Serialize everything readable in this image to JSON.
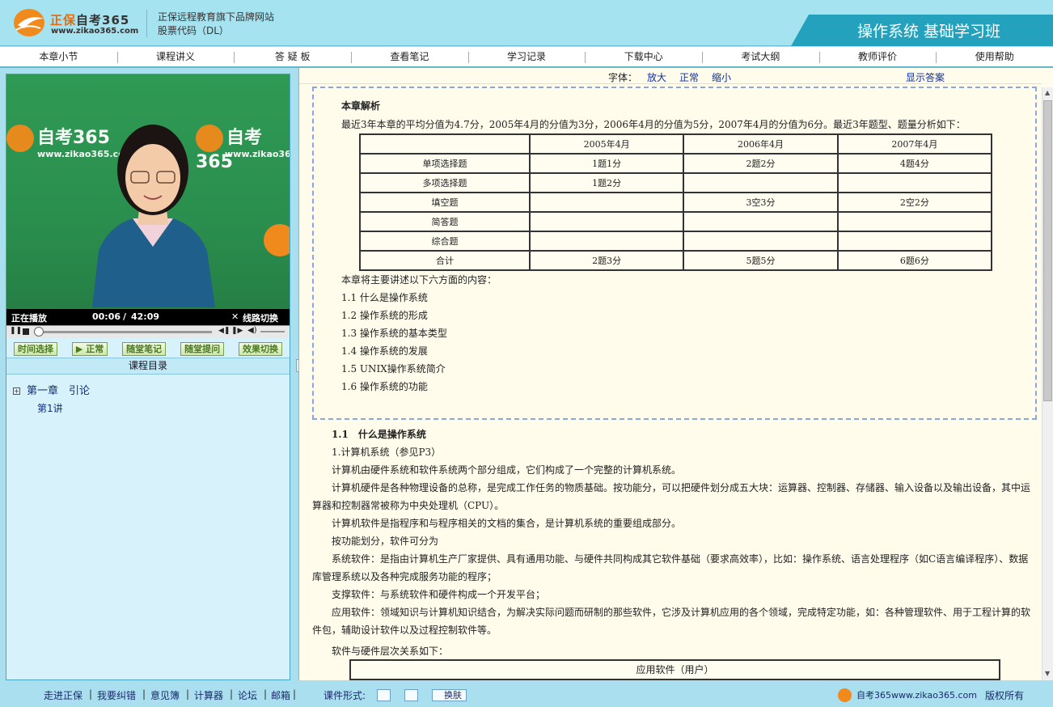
{
  "header": {
    "logo_brand": "正保",
    "logo_name": "自考365",
    "logo_url": "www.zikao365.com",
    "tagline_1": "正保远程教育旗下品牌网站",
    "tagline_2": "股票代码（DL）",
    "course_title": "操作系统 基础学习班"
  },
  "nav": [
    "本章小节",
    "课程讲义",
    "答 疑 板",
    "查看笔记",
    "学习记录",
    "下载中心",
    "考试大纲",
    "教师评价",
    "使用帮助"
  ],
  "video": {
    "watermark_text": "自考365",
    "watermark_url": "www.zikao365.com",
    "status": "正在播放",
    "time_current": "00:06",
    "time_separator": "/",
    "time_total": "42:09",
    "switch_label": "线路切换",
    "buttons": [
      "时间选择",
      "正常",
      "随堂笔记",
      "随堂提问",
      "效果切换"
    ]
  },
  "directory": {
    "title": "课程目录",
    "chapter": "第一章　引论",
    "lesson": "第1讲"
  },
  "fontbar": {
    "label": "字体：",
    "enlarge": "放大",
    "normal": "正常",
    "shrink": "缩小",
    "show_answer": "显示答案"
  },
  "analysis": {
    "heading": "本章解析",
    "intro": "最近3年本章的平均分值为4.7分，2005年4月的分值为3分，2006年4月的分值为5分，2007年4月的分值为6分。最近3年题型、题量分析如下：",
    "table": {
      "headers": [
        "",
        "2005年4月",
        "2006年4月",
        "2007年4月"
      ],
      "rows": [
        [
          "单项选择题",
          "1题1分",
          "2题2分",
          "4题4分"
        ],
        [
          "多项选择题",
          "1题2分",
          "",
          ""
        ],
        [
          "填空题",
          "",
          "3空3分",
          "2空2分"
        ],
        [
          "简答题",
          "",
          "",
          ""
        ],
        [
          "综合题",
          "",
          "",
          ""
        ],
        [
          "合计",
          "2题3分",
          "5题5分",
          "6题6分"
        ]
      ]
    },
    "outline_intro": "本章将主要讲述以下六方面的内容：",
    "outline": [
      "1.1 什么是操作系统",
      "1.2 操作系统的形成",
      "1.3 操作系统的基本类型",
      "1.4 操作系统的发展",
      "1.5 UNIX操作系统简介",
      "1.6 操作系统的功能"
    ]
  },
  "content": {
    "section_title": "1.1　什么是操作系统",
    "lines": [
      "1.计算机系统（参见P3）",
      "计算机由硬件系统和软件系统两个部分组成，它们构成了一个完整的计算机系统。",
      "计算机硬件是各种物理设备的总称，是完成工作任务的物质基础。按功能分，可以把硬件划分成五大块：运算器、控制器、存储器、输入设备以及输出设备，其中运",
      "算器和控制器常被称为中央处理机（CPU）。",
      "计算机软件是指程序和与程序相关的文档的集合，是计算机系统的重要组成部分。",
      "按功能划分，软件可分为",
      "系统软件：是指由计算机生产厂家提供、具有通用功能、与硬件共同构成其它软件基础（要求高效率），比如：操作系统、语言处理程序（如C语言编译程序）、数据",
      "库管理系统以及各种完成服务功能的程序；",
      "支撑软件：与系统软件和硬件构成一个开发平台；",
      "应用软件：领域知识与计算机知识结合，为解决实际问题而研制的那些软件，它涉及计算机应用的各个领域，完成特定功能，如：各种管理软件、用于工程计算的软",
      "件包，辅助设计软件以及过程控制软件等。",
      "软件与硬件层次关系如下："
    ],
    "box_label": "应用软件（用户）"
  },
  "footer": {
    "links": [
      "走进正保",
      "我要纠错",
      "意见簿",
      "计算器",
      "论坛",
      "邮箱"
    ],
    "courseware_label": "课件形式:",
    "skin_label": "换肤",
    "brand_url": "自考365www.zikao365.com",
    "copyright": "版权所有"
  }
}
